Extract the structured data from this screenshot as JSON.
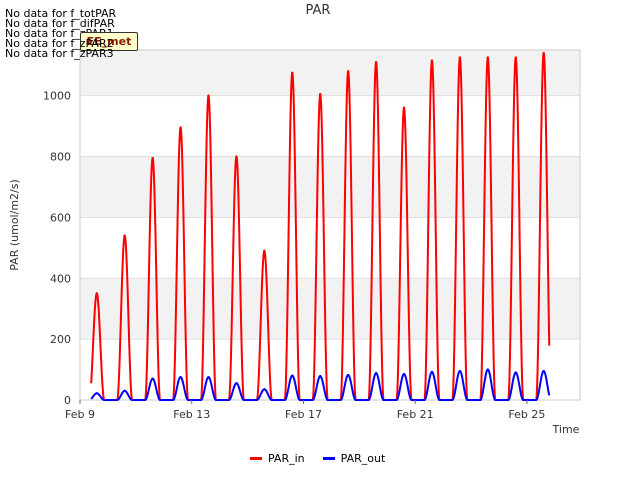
{
  "nodata_lines": [
    "No data for f_totPAR",
    "No data for f_difPAR",
    "No data for f_zPAR1",
    "No data for f_zPAR2",
    "No data for f_zPAR3"
  ],
  "badge_label": "EE_met",
  "chart_data": {
    "type": "line",
    "title": "PAR",
    "xlabel": "Time",
    "ylabel": "PAR (umol/m2/s)",
    "ylim": [
      0,
      1150
    ],
    "xlim": [
      9.0,
      26.9
    ],
    "yticks": [
      0,
      200,
      400,
      600,
      800,
      1000
    ],
    "xticks": [
      {
        "value": 9,
        "label": "Feb 9"
      },
      {
        "value": 13,
        "label": "Feb 13"
      },
      {
        "value": 17,
        "label": "Feb 17"
      },
      {
        "value": 21,
        "label": "Feb 21"
      },
      {
        "value": 25,
        "label": "Feb 25"
      }
    ],
    "grid": true,
    "legend_position": "bottom-center",
    "colors": {
      "PAR_in": "#ff0000",
      "PAR_out": "#0000ff",
      "band": "#f2f2f2"
    },
    "series": [
      {
        "name": "PAR_in",
        "daily_peaks": [
          {
            "day": 9.6,
            "peak": 350
          },
          {
            "day": 10.6,
            "peak": 540
          },
          {
            "day": 11.6,
            "peak": 795
          },
          {
            "day": 12.6,
            "peak": 895
          },
          {
            "day": 13.6,
            "peak": 1000
          },
          {
            "day": 14.6,
            "peak": 800
          },
          {
            "day": 15.6,
            "peak": 490
          },
          {
            "day": 16.6,
            "peak": 1075
          },
          {
            "day": 17.6,
            "peak": 1005
          },
          {
            "day": 18.6,
            "peak": 1080
          },
          {
            "day": 19.6,
            "peak": 1110
          },
          {
            "day": 20.6,
            "peak": 960
          },
          {
            "day": 21.6,
            "peak": 1115
          },
          {
            "day": 22.6,
            "peak": 1125
          },
          {
            "day": 23.6,
            "peak": 1125
          },
          {
            "day": 24.6,
            "peak": 1125
          },
          {
            "day": 25.6,
            "peak": 1140
          }
        ]
      },
      {
        "name": "PAR_out",
        "daily_peaks": [
          {
            "day": 9.6,
            "peak": 22
          },
          {
            "day": 10.6,
            "peak": 30
          },
          {
            "day": 11.6,
            "peak": 70
          },
          {
            "day": 12.6,
            "peak": 75
          },
          {
            "day": 13.6,
            "peak": 75
          },
          {
            "day": 14.6,
            "peak": 55
          },
          {
            "day": 15.6,
            "peak": 35
          },
          {
            "day": 16.6,
            "peak": 80
          },
          {
            "day": 17.6,
            "peak": 78
          },
          {
            "day": 18.6,
            "peak": 82
          },
          {
            "day": 19.6,
            "peak": 88
          },
          {
            "day": 20.6,
            "peak": 85
          },
          {
            "day": 21.6,
            "peak": 92
          },
          {
            "day": 22.6,
            "peak": 95
          },
          {
            "day": 23.6,
            "peak": 100
          },
          {
            "day": 24.6,
            "peak": 90
          },
          {
            "day": 25.6,
            "peak": 95
          }
        ]
      }
    ]
  }
}
